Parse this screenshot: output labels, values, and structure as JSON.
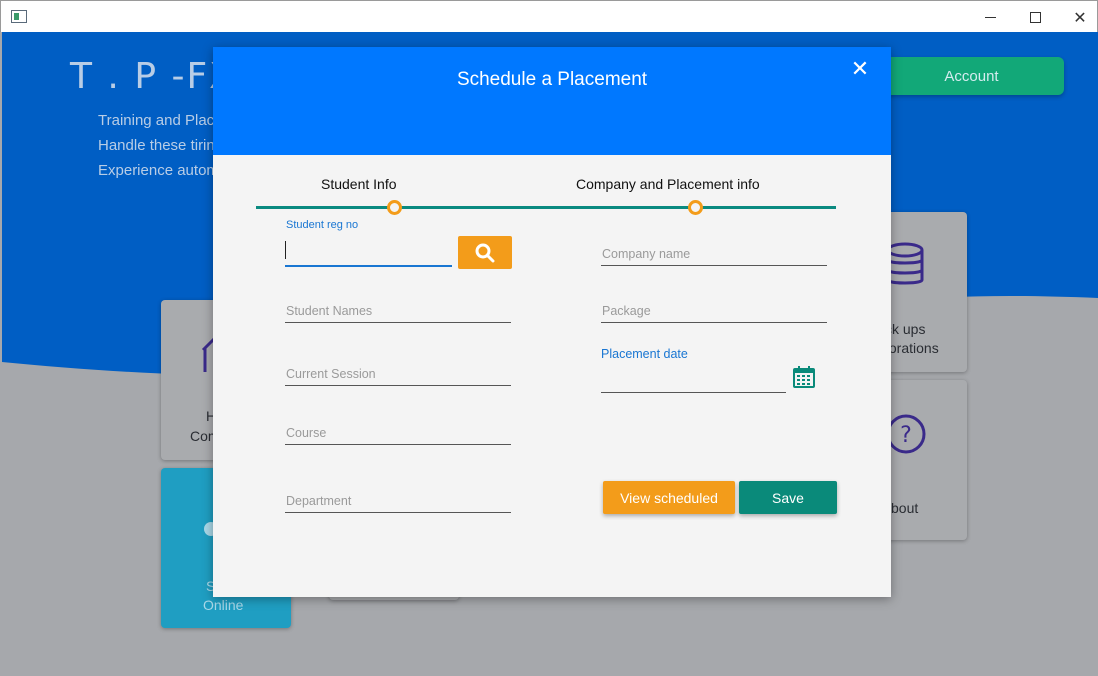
{
  "window": {
    "minimize_icon": "minimize-icon",
    "maximize_icon": "maximize-icon",
    "close_icon": "close-icon"
  },
  "background": {
    "brand": "T . P -FX",
    "taglines": [
      "Training and Place",
      "Handle these tirin",
      "Experience autom"
    ],
    "account_button": "Account",
    "tiles": {
      "home_text_1": "H",
      "home_text_2": "Com",
      "online_text_1": "S",
      "online_text_2": "Online",
      "backup_text_1": "ck ups",
      "backup_text_2": "torations",
      "about_text": "bout"
    },
    "colors": {
      "blue": "#005ec4",
      "green": "#12a878",
      "teal_tile": "#1f9ec2"
    }
  },
  "modal": {
    "title": "Schedule a Placement",
    "close_label": "✕",
    "steps": [
      "Student Info",
      "Company and Placement info"
    ],
    "left": {
      "reg_no_label": "Student reg no",
      "reg_no_value": "",
      "student_names": "Student Names",
      "current_session": "Current Session",
      "course": "Course",
      "department": "Department"
    },
    "right": {
      "company_name": "Company name",
      "package": "Package",
      "placement_date_label": "Placement date",
      "placement_date_value": ""
    },
    "buttons": {
      "view_scheduled": "View scheduled",
      "save": "Save"
    },
    "colors": {
      "header": "#0078ff",
      "orange": "#f39c1a",
      "teal": "#0a8a7a"
    }
  }
}
